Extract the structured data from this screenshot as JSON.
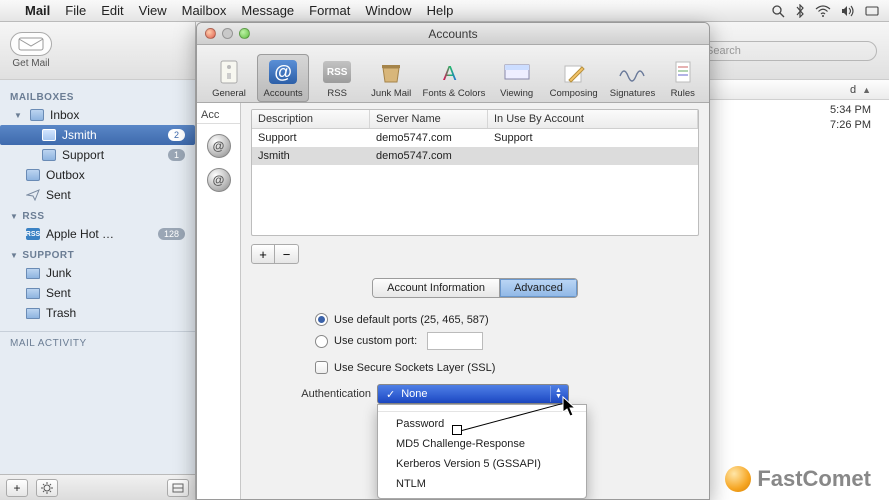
{
  "menubar": {
    "app": "Mail",
    "items": [
      "File",
      "Edit",
      "View",
      "Mailbox",
      "Message",
      "Format",
      "Window",
      "Help"
    ]
  },
  "sidebar": {
    "getmail_label": "Get Mail",
    "sections": {
      "mailboxes": "MAILBOXES",
      "rss": "RSS",
      "support": "SUPPORT",
      "activity": "MAIL ACTIVITY"
    },
    "inbox": "Inbox",
    "jsmith": "Jsmith",
    "jsmith_badge": "2",
    "support_item": "Support",
    "support_badge": "1",
    "outbox": "Outbox",
    "sent": "Sent",
    "rss_item": "Apple Hot …",
    "rss_badge": "128",
    "junk": "Junk",
    "sent2": "Sent",
    "trash": "Trash"
  },
  "search": {
    "placeholder": "Search"
  },
  "messages": {
    "col_received": "d",
    "rows": [
      "5:34 PM",
      "7:26 PM"
    ]
  },
  "pref": {
    "title": "Accounts",
    "toolbar": {
      "general": "General",
      "accounts": "Accounts",
      "rss": "RSS",
      "junk": "Junk Mail",
      "fonts": "Fonts & Colors",
      "viewing": "Viewing",
      "composing": "Composing",
      "signatures": "Signatures",
      "rules": "Rules"
    },
    "accounts_header": "Acc",
    "server_table": {
      "headers": {
        "desc": "Description",
        "server": "Server Name",
        "inuse": "In Use By Account"
      },
      "rows": [
        {
          "desc": "Support",
          "server": "demo5747.com",
          "inuse": "Support"
        },
        {
          "desc": "Jsmith",
          "server": "demo5747.com",
          "inuse": ""
        }
      ]
    },
    "tabs": {
      "info": "Account Information",
      "advanced": "Advanced"
    },
    "ports": {
      "use_default": "Use default ports (25, 465, 587)",
      "use_custom": "Use custom port:"
    },
    "ssl_label": "Use Secure Sockets Layer (SSL)",
    "auth_label": "Authentication",
    "auth_menu": {
      "selected": "None",
      "options": [
        "Password",
        "MD5 Challenge-Response",
        "Kerberos Version 5 (GSSAPI)",
        "NTLM"
      ]
    }
  },
  "watermark": {
    "text": "FastComet"
  }
}
